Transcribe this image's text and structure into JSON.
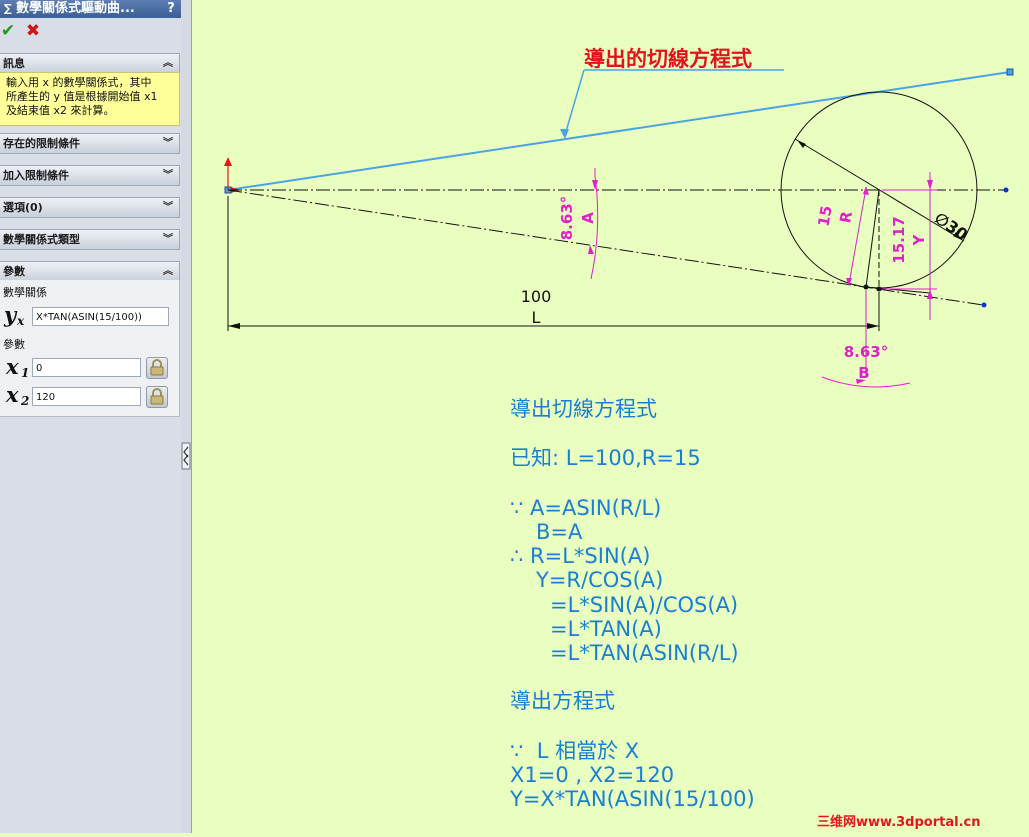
{
  "panel": {
    "title": "數學關係式驅動曲...",
    "help_icon": "?",
    "ok_icon": "check-icon",
    "cancel_icon": "close-icon",
    "sections": {
      "message": "訊息",
      "existing_constraints": "存在的限制條件",
      "add_constraints": "加入限制條件",
      "options": "選項(0)",
      "equation_type": "數學關係式類型",
      "parameters": "參數"
    },
    "message_lines": [
      "輸入用 x 的數學關係式，其中",
      "所產生的 y 值是根據開始值 x1",
      "及結束值 x2 來計算。"
    ],
    "equation_label": "數學關係",
    "y_symbol": "y",
    "y_subscript": "x",
    "equation_value": "X*TAN(ASIN(15/100))",
    "params_label": "參數",
    "x_symbol": "x",
    "x1_subscript": "1",
    "x2_subscript": "2",
    "x1_value": "0",
    "x2_value": "120"
  },
  "drawing": {
    "callout": "導出的切線方程式",
    "dim_length": "100",
    "dim_length_name": "L",
    "dim_angle_a": "8.63°",
    "dim_angle_a_name": "A",
    "dim_angle_b": "8.63°",
    "dim_angle_b_name": "B",
    "dim_radius": "15",
    "dim_radius_name": "R",
    "dim_y": "15.17",
    "dim_y_name": "Y",
    "dim_diameter": "∅30"
  },
  "derivation": {
    "line1": "導出切線方程式",
    "line2": "已知: L=100,R=15",
    "line3": "∵ A=ASIN(R/L)",
    "line4": "B=A",
    "line5": "∴ R=L*SIN(A)",
    "line6": "Y=R/COS(A)",
    "line7": "=L*SIN(A)/COS(A)",
    "line8": "=L*TAN(A)",
    "line9": "=L*TAN(ASIN(R/L)",
    "line10": "導出方程式",
    "line11": "∵  L 相當於 X",
    "line12": "X1=0 , X2=120",
    "line13": "Y=X*TAN(ASIN(15/100)"
  },
  "watermark": "三维网www.3dportal.cn",
  "colors": {
    "background": "#e9ffc0",
    "dimension": "#e020c8",
    "tangent_line": "#4aa3e6",
    "derivation_text": "#1a7fd4",
    "callout": "#e0141e"
  }
}
